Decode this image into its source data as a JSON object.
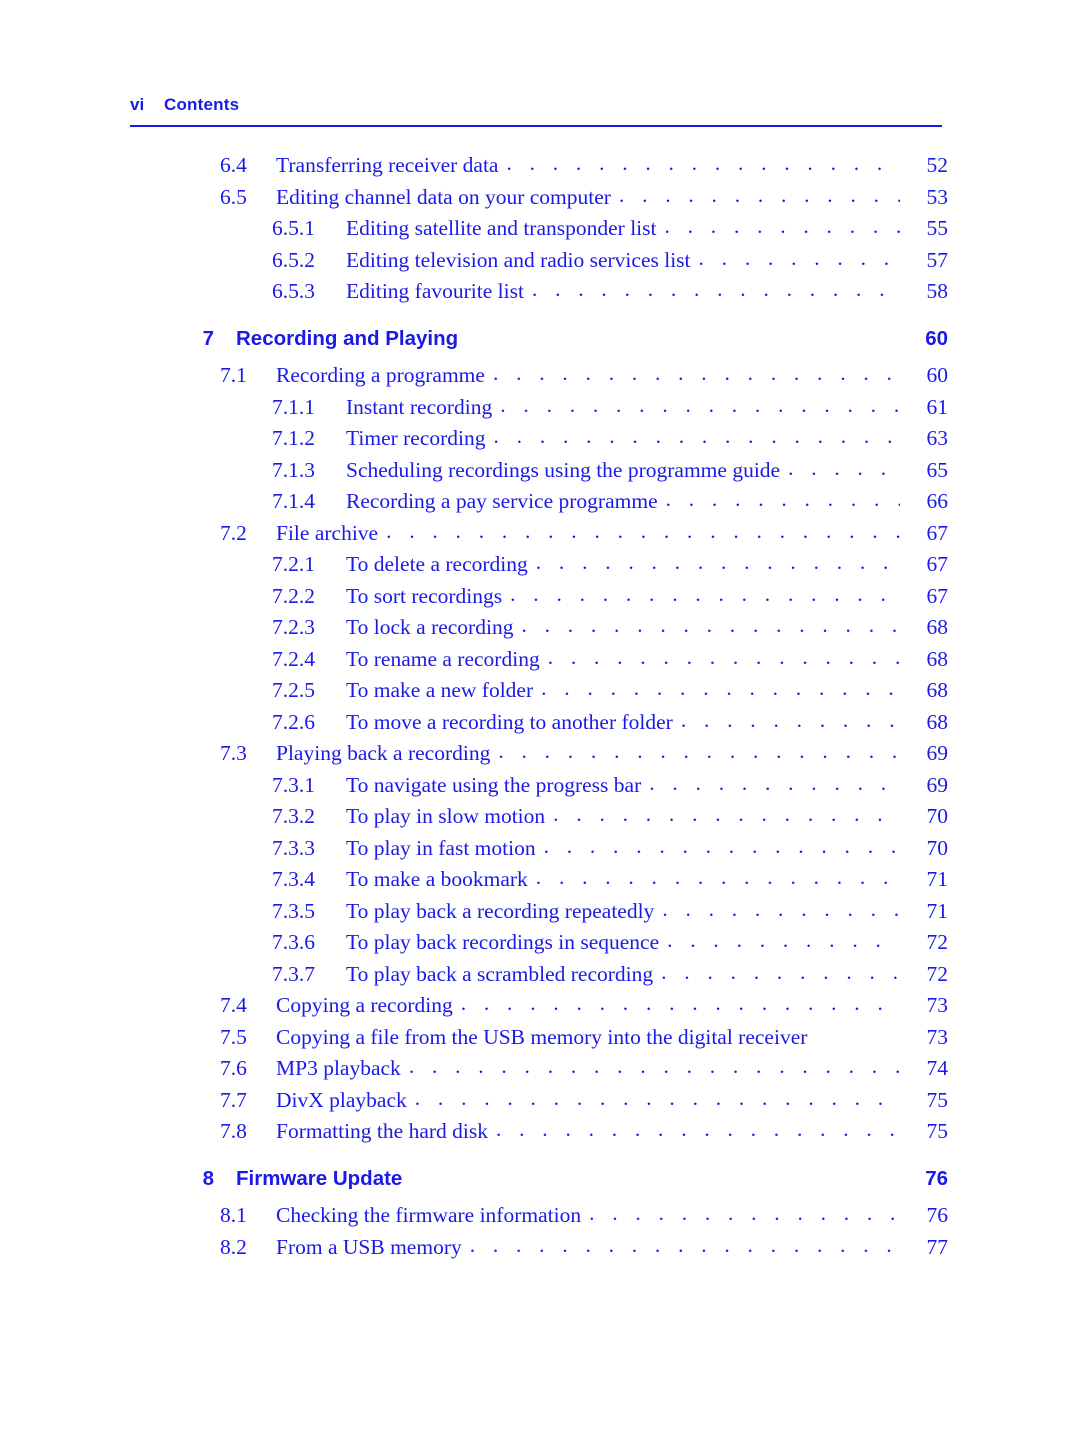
{
  "header": {
    "folio": "vi",
    "title": "Contents"
  },
  "colors": {
    "text": "#1a1ae6",
    "rule": "#1a1ae6"
  },
  "toc": {
    "entries": [
      {
        "level": 2,
        "num": "6.4",
        "title": "Transferring receiver data",
        "page": "52"
      },
      {
        "level": 2,
        "num": "6.5",
        "title": "Editing channel data on your computer",
        "page": "53"
      },
      {
        "level": 3,
        "num": "6.5.1",
        "title": "Editing satellite and transponder list",
        "page": "55"
      },
      {
        "level": 3,
        "num": "6.5.2",
        "title": "Editing television and radio services list",
        "page": "57"
      },
      {
        "level": 3,
        "num": "6.5.3",
        "title": "Editing favourite list",
        "page": "58"
      },
      {
        "level": 1,
        "num": "7",
        "title": "Recording and Playing",
        "page": "60"
      },
      {
        "level": 2,
        "num": "7.1",
        "title": "Recording a programme",
        "page": "60"
      },
      {
        "level": 3,
        "num": "7.1.1",
        "title": "Instant recording",
        "page": "61"
      },
      {
        "level": 3,
        "num": "7.1.2",
        "title": "Timer recording",
        "page": "63"
      },
      {
        "level": 3,
        "num": "7.1.3",
        "title": "Scheduling recordings using the programme guide",
        "page": "65"
      },
      {
        "level": 3,
        "num": "7.1.4",
        "title": "Recording a pay service programme",
        "page": "66"
      },
      {
        "level": 2,
        "num": "7.2",
        "title": "File archive",
        "page": "67"
      },
      {
        "level": 3,
        "num": "7.2.1",
        "title": "To delete a recording",
        "page": "67"
      },
      {
        "level": 3,
        "num": "7.2.2",
        "title": "To sort recordings",
        "page": "67"
      },
      {
        "level": 3,
        "num": "7.2.3",
        "title": "To lock a recording",
        "page": "68"
      },
      {
        "level": 3,
        "num": "7.2.4",
        "title": "To rename a recording",
        "page": "68"
      },
      {
        "level": 3,
        "num": "7.2.5",
        "title": "To make a new folder",
        "page": "68"
      },
      {
        "level": 3,
        "num": "7.2.6",
        "title": "To move a recording to another folder",
        "page": "68"
      },
      {
        "level": 2,
        "num": "7.3",
        "title": "Playing back a recording",
        "page": "69"
      },
      {
        "level": 3,
        "num": "7.3.1",
        "title": "To navigate using the progress bar",
        "page": "69"
      },
      {
        "level": 3,
        "num": "7.3.2",
        "title": "To play in slow motion",
        "page": "70"
      },
      {
        "level": 3,
        "num": "7.3.3",
        "title": "To play in fast motion",
        "page": "70"
      },
      {
        "level": 3,
        "num": "7.3.4",
        "title": "To make a bookmark",
        "page": "71"
      },
      {
        "level": 3,
        "num": "7.3.5",
        "title": "To play back a recording repeatedly",
        "page": "71"
      },
      {
        "level": 3,
        "num": "7.3.6",
        "title": "To play back recordings in sequence",
        "page": "72"
      },
      {
        "level": 3,
        "num": "7.3.7",
        "title": "To play back a scrambled recording",
        "page": "72"
      },
      {
        "level": 2,
        "num": "7.4",
        "title": "Copying a recording",
        "page": "73"
      },
      {
        "level": 2,
        "num": "7.5",
        "title": "Copying a file from the USB memory into the digital receiver",
        "page": "73",
        "noleader": true
      },
      {
        "level": 2,
        "num": "7.6",
        "title": "MP3 playback",
        "page": "74"
      },
      {
        "level": 2,
        "num": "7.7",
        "title": "DivX playback",
        "page": "75"
      },
      {
        "level": 2,
        "num": "7.8",
        "title": "Formatting the hard disk",
        "page": "75"
      },
      {
        "level": 1,
        "num": "8",
        "title": "Firmware Update",
        "page": "76"
      },
      {
        "level": 2,
        "num": "8.1",
        "title": "Checking the firmware information",
        "page": "76"
      },
      {
        "level": 2,
        "num": "8.2",
        "title": "From a USB memory",
        "page": "77"
      }
    ]
  }
}
